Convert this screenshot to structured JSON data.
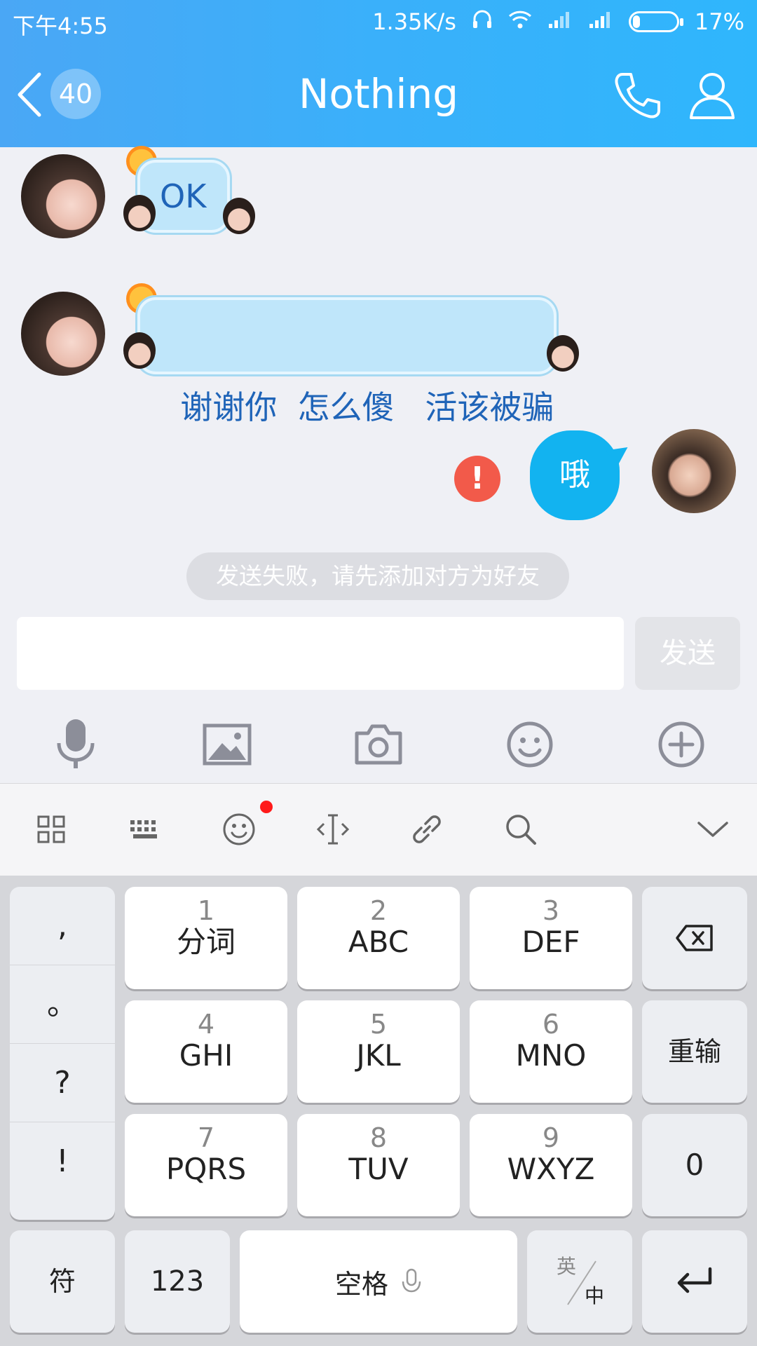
{
  "status": {
    "time": "下午4:55",
    "speed": "1.35K/s",
    "battery_pct": "17%",
    "battery_level": 0.17
  },
  "header": {
    "unread_count": "40",
    "title": "Nothing"
  },
  "messages": [
    {
      "side": "left",
      "text": "OK"
    },
    {
      "side": "left",
      "text": "谢谢你  怎么傻   活该被骗"
    },
    {
      "side": "right",
      "text": "哦",
      "status": "!"
    }
  ],
  "notice": "发送失败，请先添加对方为好友",
  "composer": {
    "send_label": "发送"
  },
  "toolbar_icons": [
    "microphone-icon",
    "image-icon",
    "camera-icon",
    "emoji-icon",
    "plus-circle-icon"
  ],
  "keyboard_bar_icons": [
    "grid-icon",
    "keyboard-icon",
    "emoji-icon",
    "text-cursor-icon",
    "link-icon",
    "search-icon",
    "chevron-down-icon"
  ],
  "keyboard": {
    "punct": [
      ",",
      "。",
      "?",
      "!"
    ],
    "keys": [
      {
        "num": "1",
        "let": "分词"
      },
      {
        "num": "2",
        "let": "ABC"
      },
      {
        "num": "3",
        "let": "DEF"
      },
      {
        "num": "4",
        "let": "GHI"
      },
      {
        "num": "5",
        "let": "JKL"
      },
      {
        "num": "6",
        "let": "MNO"
      },
      {
        "num": "7",
        "let": "PQRS"
      },
      {
        "num": "8",
        "let": "TUV"
      },
      {
        "num": "9",
        "let": "WXYZ"
      }
    ],
    "reinput": "重输",
    "zero": "0",
    "symbol": "符",
    "num_mode": "123",
    "space": "空格",
    "lang_top": "英",
    "lang_bottom": "中"
  }
}
